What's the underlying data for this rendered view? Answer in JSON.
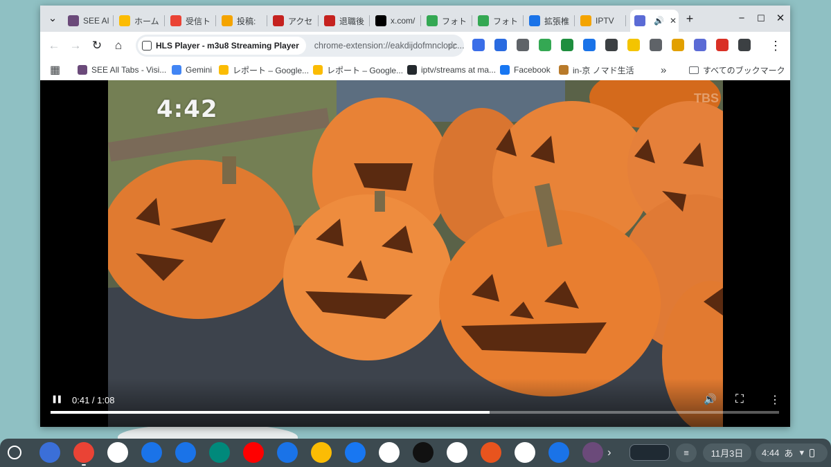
{
  "browser": {
    "tabs": [
      {
        "label": "SEE Al",
        "icon": "visi-icon",
        "color": "#6b4a7a"
      },
      {
        "label": "ホーム",
        "icon": "google-ads-icon",
        "color": "#fbbc04"
      },
      {
        "label": "受信ト",
        "icon": "gmail-icon",
        "color": "#ea4335"
      },
      {
        "label": "投稿:",
        "icon": "blogger-icon",
        "color": "#f4a400"
      },
      {
        "label": "アクセ",
        "icon": "red-circle-icon",
        "color": "#c5221f"
      },
      {
        "label": "退職後",
        "icon": "red-circle-icon",
        "color": "#c5221f"
      },
      {
        "label": "x.com/",
        "icon": "x-icon",
        "color": "#000000"
      },
      {
        "label": "フォト",
        "icon": "google-photos-icon",
        "color": "#34a853"
      },
      {
        "label": "フォト",
        "icon": "google-photos-icon",
        "color": "#34a853"
      },
      {
        "label": "拡張椎",
        "icon": "puzzle-icon",
        "color": "#1a73e8"
      },
      {
        "label": "IPTV",
        "icon": "blogger-icon",
        "color": "#f4a400"
      },
      {
        "label": "",
        "icon": "hls-player-icon",
        "color": "#5b6bd5",
        "active": true,
        "audio": "🔊",
        "close": "✕"
      }
    ],
    "new_tab": "+",
    "window_controls": {
      "minimize": "−",
      "maximize": "☐",
      "close": "✕"
    },
    "tab_search": "⌄"
  },
  "toolbar": {
    "back": "←",
    "forward": "→",
    "reload": "↻",
    "home": "⌂",
    "chip_title": "HLS Player - m3u8 Streaming Player",
    "url": "chrome-extension://eakdijdofmnclopc...",
    "bookmark_star": "☆",
    "menu": "⋮",
    "extensions_button": "⧉"
  },
  "extensions": [
    {
      "icon": "share-icon",
      "color": "#3a6ee8"
    },
    {
      "icon": "wifi-icon",
      "color": "#2a6be0"
    },
    {
      "icon": "eyedropper-icon",
      "color": "#5f6368"
    },
    {
      "icon": "doc-icon",
      "color": "#34a853"
    },
    {
      "icon": "qr-icon",
      "color": "#1e8e3e"
    },
    {
      "icon": "note-icon",
      "color": "#1a73e8"
    },
    {
      "icon": "globe-icon",
      "color": "#3c4043"
    },
    {
      "icon": "pacman-icon",
      "color": "#f4c400"
    },
    {
      "icon": "play-icon",
      "color": "#5f6368"
    },
    {
      "icon": "clipboard-icon",
      "color": "#e2a000"
    },
    {
      "icon": "hls-icon",
      "color": "#5b6bd5"
    },
    {
      "icon": "heart-icon",
      "color": "#d93025"
    },
    {
      "icon": "puzzle-icon",
      "color": "#3c4043"
    }
  ],
  "bookmarks": {
    "apps_icon": "▦",
    "items": [
      {
        "label": "SEE All Tabs - Visi...",
        "icon": "visi-icon",
        "color": "#6b4a7a"
      },
      {
        "label": "Gemini",
        "icon": "gemini-icon",
        "color": "#4285f4"
      },
      {
        "label": "レポート – Google...",
        "icon": "google-ads-icon",
        "color": "#fbbc04"
      },
      {
        "label": "レポート – Google...",
        "icon": "google-ads-icon",
        "color": "#fbbc04"
      },
      {
        "label": "iptv/streams at ma...",
        "icon": "github-icon",
        "color": "#24292e"
      },
      {
        "label": "Facebook",
        "icon": "facebook-icon",
        "color": "#1877f2"
      },
      {
        "label": "in-京 ノマド生活",
        "icon": "pointer-icon",
        "color": "#b87a2a"
      }
    ],
    "overflow": "»",
    "all_bookmarks": "すべてのブックマーク"
  },
  "player": {
    "overlay_clock": "4:42",
    "watermark": "TBS",
    "play_pause": "❚❚",
    "time": "0:41 / 1:08",
    "volume": "🔊",
    "fullscreen": "⛶",
    "more": "⋮",
    "progress": 0.603
  },
  "shelf": {
    "apps": [
      {
        "icon": "gemini-icon",
        "color": "#3b6fd8"
      },
      {
        "icon": "chrome-icon",
        "color": "#ea4335",
        "running": true
      },
      {
        "icon": "gmail-icon",
        "color": "#ffffff"
      },
      {
        "icon": "calendar-icon",
        "color": "#1a73e8"
      },
      {
        "icon": "files-icon",
        "color": "#1a73e8"
      },
      {
        "icon": "meet-icon",
        "color": "#00897b"
      },
      {
        "icon": "youtube-icon",
        "color": "#ff0000"
      },
      {
        "icon": "messages-icon",
        "color": "#1a73e8"
      },
      {
        "icon": "photos-icon",
        "color": "#fbbc04"
      },
      {
        "icon": "facebook-icon",
        "color": "#1877f2"
      },
      {
        "icon": "chatgpt-icon",
        "color": "#ffffff"
      },
      {
        "icon": "sparkle-icon",
        "color": "#111111"
      },
      {
        "icon": "pattern-icon",
        "color": "#ffffff"
      },
      {
        "icon": "analytics-icon",
        "color": "#e8541e"
      },
      {
        "icon": "ai-icon",
        "color": "#ffffff"
      },
      {
        "icon": "q-icon",
        "color": "#1a73e8"
      },
      {
        "icon": "visi-icon",
        "color": "#6b4a7a"
      }
    ],
    "overflow": "›",
    "date": "11月3日",
    "time": "4:44",
    "ime": "あ"
  }
}
